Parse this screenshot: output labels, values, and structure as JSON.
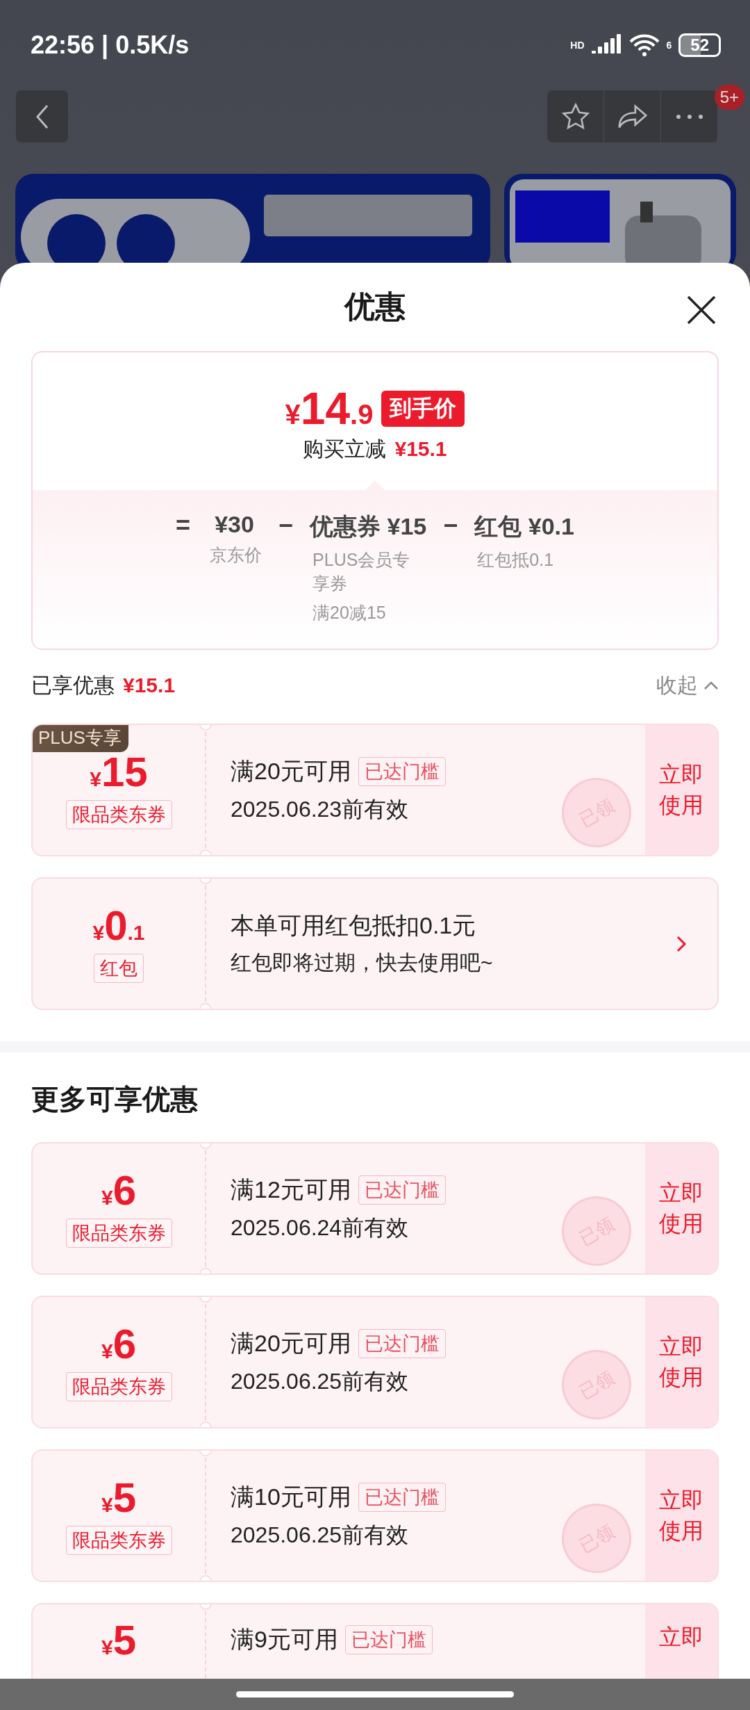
{
  "status_bar": {
    "time": "22:56 | 0.5K/s",
    "network": "HD",
    "wifi": "6",
    "battery": "52"
  },
  "nav": {
    "badge": "5+"
  },
  "sheet": {
    "title": "优惠"
  },
  "price_card": {
    "currency": "¥",
    "price_int": "14",
    "price_dec": ".9",
    "price_tag": "到手价",
    "reduce_label": "购买立减",
    "reduce_value": "¥15.1",
    "formula": [
      {
        "kind": "op",
        "text": "="
      },
      {
        "kind": "term",
        "value": "¥30",
        "note": [
          "京东价"
        ]
      },
      {
        "kind": "op",
        "text": "−"
      },
      {
        "kind": "term",
        "value": "优惠券 ¥15",
        "note": [
          "PLUS会员专享券",
          "满20减15"
        ]
      },
      {
        "kind": "op",
        "text": "−"
      },
      {
        "kind": "term",
        "value": "红包 ¥0.1",
        "note": [
          "红包抵0.1"
        ]
      }
    ]
  },
  "enjoyed": {
    "label": "已享优惠",
    "amount": "¥15.1",
    "toggle": "收起",
    "items": [
      {
        "kind": "coupon",
        "badge": "PLUS专享",
        "currency": "¥",
        "amount": "15",
        "type": "限品类东券",
        "condition": "满20元可用",
        "tag": "已达门槛",
        "expiry": "2025.06.23前有效",
        "action": "立即使用",
        "stamp": "已领"
      },
      {
        "kind": "red_packet",
        "currency": "¥",
        "amount": "0",
        "decimal": ".1",
        "type": "红包",
        "title": "本单可用红包抵扣0.1元",
        "subtitle": "红包即将过期，快去使用吧~"
      }
    ]
  },
  "more": {
    "title": "更多可享优惠",
    "items": [
      {
        "kind": "coupon",
        "currency": "¥",
        "amount": "6",
        "type": "限品类东券",
        "condition": "满12元可用",
        "tag": "已达门槛",
        "expiry": "2025.06.24前有效",
        "action": "立即使用",
        "stamp": "已领"
      },
      {
        "kind": "coupon",
        "currency": "¥",
        "amount": "6",
        "type": "限品类东券",
        "condition": "满20元可用",
        "tag": "已达门槛",
        "expiry": "2025.06.25前有效",
        "action": "立即使用",
        "stamp": "已领"
      },
      {
        "kind": "coupon",
        "currency": "¥",
        "amount": "5",
        "type": "限品类东券",
        "condition": "满10元可用",
        "tag": "已达门槛",
        "expiry": "2025.06.25前有效",
        "action": "立即使用",
        "stamp": "已领"
      },
      {
        "kind": "coupon",
        "currency": "¥",
        "amount": "5",
        "condition": "满9元可用",
        "tag": "已达门槛",
        "action": "立即"
      }
    ]
  }
}
